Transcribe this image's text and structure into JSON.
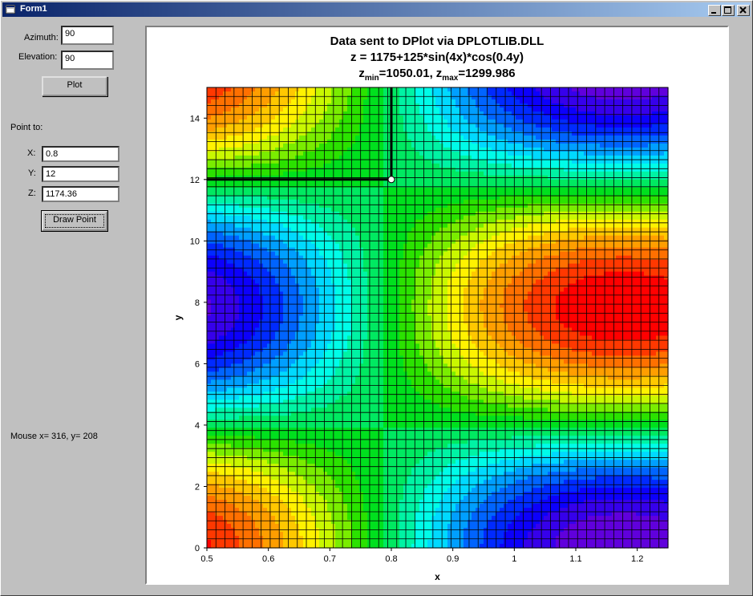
{
  "window": {
    "title": "Form1",
    "buttons": [
      "minimize",
      "maximize",
      "close"
    ]
  },
  "controls": {
    "azimuth_label": "Azimuth:",
    "azimuth_value": "90",
    "elevation_label": "Elevation:",
    "elevation_value": "90",
    "plot_button": "Plot",
    "point_to_label": "Point to:",
    "x_label": "X:",
    "x_value": "0.8",
    "y_label": "Y:",
    "y_value": "12",
    "z_label": "Z:",
    "z_value": "1174.36",
    "draw_point_button": "Draw Point",
    "mouse_status": "Mouse x= 316, y= 208"
  },
  "plot": {
    "title1": "Data sent to DPlot via DPLOTLIB.DLL",
    "title2": "z = 1175+125*sin(4x)*cos(0.4y)",
    "zmin_label": "z",
    "zmin_sub": "min",
    "zmin_value": "=1050.01,",
    "zmax_label": "z",
    "zmax_sub": "max",
    "zmax_value": "=1299.986"
  },
  "chart_data": {
    "type": "heatmap",
    "function": "1175+125*sin(4x)*cos(0.4y)",
    "xlabel": "x",
    "ylabel": "y",
    "xlim": [
      0.5,
      1.25
    ],
    "ylim": [
      0,
      15
    ],
    "x_ticks": [
      "0.5",
      "0.6",
      "0.7",
      "0.8",
      "0.9",
      "1",
      "1.1",
      "1.2"
    ],
    "x_tick_values": [
      0.5,
      0.6,
      0.7,
      0.8,
      0.9,
      1.0,
      1.1,
      1.2
    ],
    "y_ticks": [
      "0",
      "2",
      "4",
      "6",
      "8",
      "10",
      "12",
      "14"
    ],
    "y_tick_values": [
      0,
      2,
      4,
      6,
      8,
      10,
      12,
      14
    ],
    "zmin": 1050.01,
    "zmax": 1299.986,
    "grid_cols": 51,
    "grid_rows": 51,
    "grid": true,
    "marked_point": {
      "x": 0.8,
      "y": 12,
      "z": 1174.36
    }
  }
}
